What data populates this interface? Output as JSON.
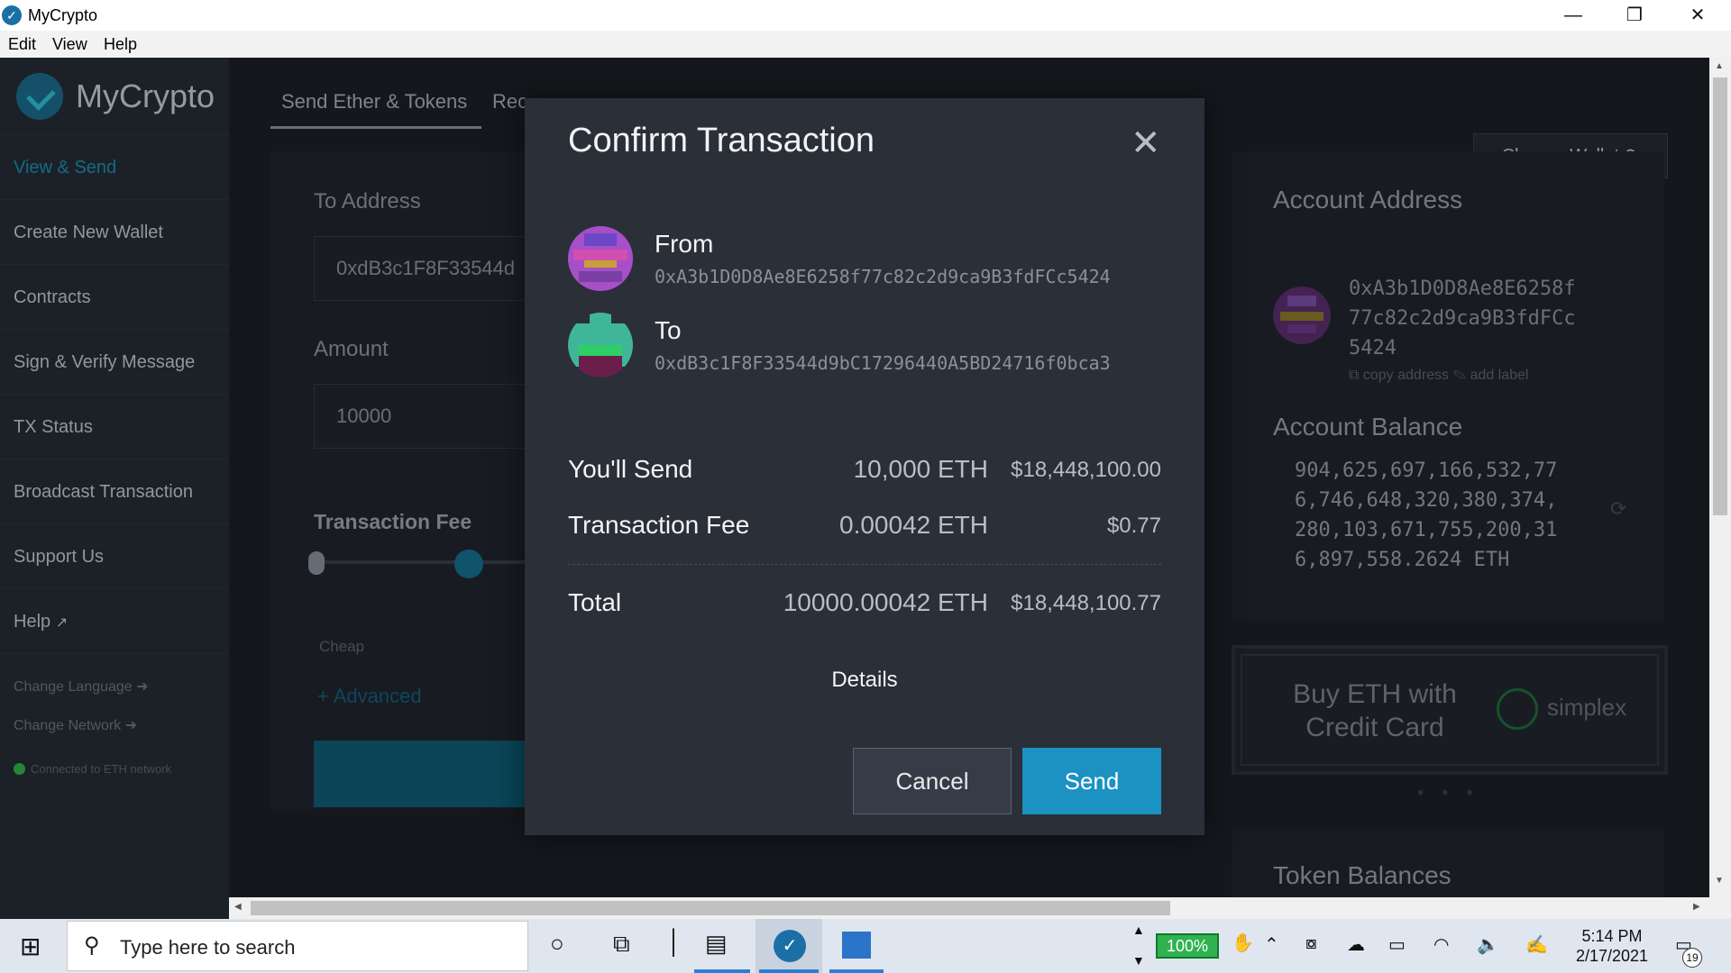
{
  "window": {
    "title": "MyCrypto",
    "menu": [
      "Edit",
      "View",
      "Help"
    ]
  },
  "sidebar": {
    "logo_text": "MyCrypto",
    "items": [
      {
        "label": "View & Send"
      },
      {
        "label": "Create New Wallet"
      },
      {
        "label": "Contracts"
      },
      {
        "label": "Sign & Verify Message"
      },
      {
        "label": "TX Status"
      },
      {
        "label": "Broadcast Transaction"
      },
      {
        "label": "Support Us"
      },
      {
        "label": "Help"
      }
    ],
    "change_language": "Change Language",
    "change_network": "Change Network",
    "network_status": "Connected to ETH network"
  },
  "main": {
    "tabs": [
      "Send Ether & Tokens",
      "Rec"
    ],
    "to_address_label": "To Address",
    "to_address_value": "0xdB3c1F8F33544d",
    "amount_label": "Amount",
    "amount_value": "10000",
    "fee_label": "Transaction Fee",
    "fee_cheap": "Cheap",
    "advanced_link": "+ Advanced",
    "change_wallet": "Change Wallet",
    "account_address_label": "Account Address",
    "account_address_lines": [
      "0xA3b1D0D8Ae8E6258f",
      "77c82c2d9ca9B3fdFCc",
      "5424"
    ],
    "copy_address": "copy address",
    "add_label": "add label",
    "account_balance_label": "Account Balance",
    "balance_lines": [
      "904,625,697,166,532,77",
      "6,746,648,320,380,374,",
      "280,103,671,755,200,31",
      "6,897,558.2624 ETH"
    ],
    "buy_eth": "Buy ETH with Credit Card",
    "simplex": "simplex",
    "token_balances": "Token Balances"
  },
  "modal": {
    "title": "Confirm Transaction",
    "from_label": "From",
    "from_address": "0xA3b1D0D8Ae8E6258f77c82c2d9ca9B3fdFCc5424",
    "to_label": "To",
    "to_address": "0xdB3c1F8F33544d9bC17296440A5BD24716f0bca3",
    "send_label": "You'll Send",
    "send_eth": "10,000 ETH",
    "send_usd": "$18,448,100.00",
    "fee_label": "Transaction Fee",
    "fee_eth": "0.00042 ETH",
    "fee_usd": "$0.77",
    "total_label": "Total",
    "total_eth": "10000.00042 ETH",
    "total_usd": "$18,448,100.77",
    "details": "Details",
    "cancel": "Cancel",
    "send": "Send"
  },
  "taskbar": {
    "search_placeholder": "Type here to search",
    "battery_pct": "100%",
    "time": "5:14 PM",
    "date": "2/17/2021",
    "notifications": "19"
  },
  "colors": {
    "accent": "#1b92c2",
    "modal_bg": "#2a2f38",
    "sidebar_bg": "#262c35"
  }
}
